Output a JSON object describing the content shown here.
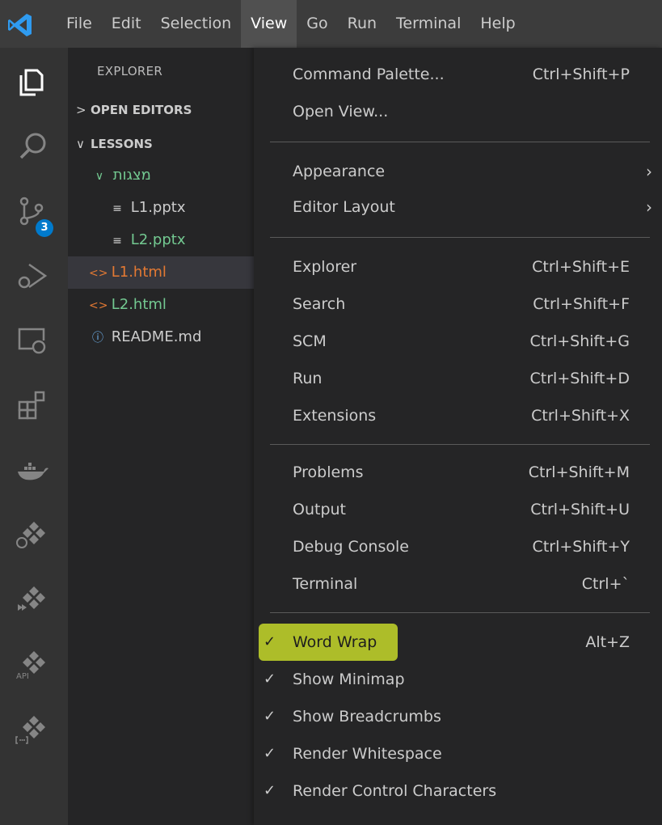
{
  "menubar": {
    "items": [
      "File",
      "Edit",
      "Selection",
      "View",
      "Go",
      "Run",
      "Terminal",
      "Help"
    ],
    "active_index": 3
  },
  "activity_bar": {
    "icons": [
      "explorer-icon",
      "search-icon",
      "source-control-icon",
      "run-debug-icon",
      "remote-explorer-icon",
      "extensions-icon",
      "docker-icon",
      "kubernetes-icon",
      "deploy-icon",
      "api-icon",
      "json-icon"
    ],
    "source_control_badge": "3",
    "api_label": "API"
  },
  "sidebar": {
    "title": "EXPLORER",
    "open_editors": "OPEN EDITORS",
    "lessons": "LESSONS",
    "tree": [
      {
        "label": "מצגות",
        "icon": "chevron-down-icon",
        "color": "#73c991"
      },
      {
        "label": "L1.pptx",
        "icon": "lines-file-icon",
        "color": "#cccccc"
      },
      {
        "label": "L2.pptx",
        "icon": "lines-file-icon",
        "color": "#73c991"
      },
      {
        "label": "L1.html",
        "icon": "html-icon",
        "color": "#e37933",
        "selected": true
      },
      {
        "label": "L2.html",
        "icon": "html-icon",
        "color": "#73c991"
      },
      {
        "label": "README.md",
        "icon": "info-icon",
        "color": "#cccccc"
      }
    ]
  },
  "view_menu": {
    "items": [
      {
        "label": "Command Palette...",
        "shortcut": "Ctrl+Shift+P"
      },
      {
        "label": "Open View...",
        "shortcut": ""
      },
      {
        "label": "Appearance",
        "submenu": true
      },
      {
        "label": "Editor Layout",
        "submenu": true
      },
      {
        "label": "Explorer",
        "shortcut": "Ctrl+Shift+E"
      },
      {
        "label": "Search",
        "shortcut": "Ctrl+Shift+F"
      },
      {
        "label": "SCM",
        "shortcut": "Ctrl+Shift+G"
      },
      {
        "label": "Run",
        "shortcut": "Ctrl+Shift+D"
      },
      {
        "label": "Extensions",
        "shortcut": "Ctrl+Shift+X"
      },
      {
        "label": "Problems",
        "shortcut": "Ctrl+Shift+M"
      },
      {
        "label": "Output",
        "shortcut": "Ctrl+Shift+U"
      },
      {
        "label": "Debug Console",
        "shortcut": "Ctrl+Shift+Y"
      },
      {
        "label": "Terminal",
        "shortcut": "Ctrl+`"
      },
      {
        "label": "Word Wrap",
        "shortcut": "Alt+Z",
        "checked": true,
        "highlighted": true
      },
      {
        "label": "Show Minimap",
        "checked": true
      },
      {
        "label": "Show Breadcrumbs",
        "checked": true
      },
      {
        "label": "Render Whitespace",
        "checked": true
      },
      {
        "label": "Render Control Characters",
        "checked": true
      }
    ],
    "check_glyph": "✓",
    "submenu_glyph": "›",
    "highlight_color": "#c6d82a"
  }
}
